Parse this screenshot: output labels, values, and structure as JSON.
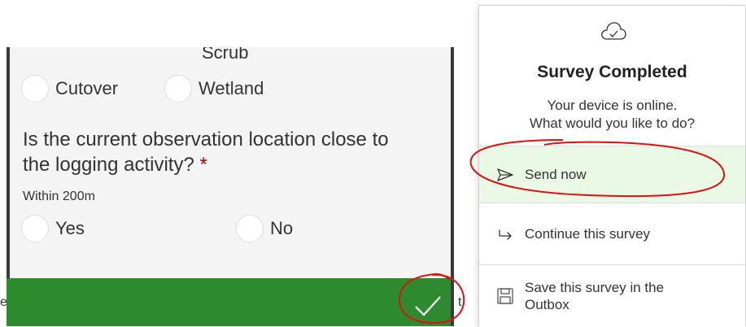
{
  "form": {
    "prev_option_fragment": "Scrub",
    "habitat_options": [
      "Cutover",
      "Wetland"
    ],
    "question": "Is the current observation location close to the logging activity?",
    "required_marker": "*",
    "hint": "Within 200m",
    "answer_options": [
      "Yes",
      "No"
    ],
    "left_edge_fragment": "e",
    "right_edge_fragment": "t",
    "submit_icon": "check-icon"
  },
  "popup": {
    "icon": "cloud-check-icon",
    "title": "Survey Completed",
    "message_line1": "Your device is online.",
    "message_line2": "What would you like to do?",
    "actions": [
      {
        "icon": "send-icon",
        "label": "Send now",
        "highlighted": true
      },
      {
        "icon": "continue-arrow-icon",
        "label": "Continue this survey"
      },
      {
        "icon": "save-icon",
        "label_line1": "Save this survey in the",
        "label_line2": "Outbox"
      }
    ]
  },
  "colors": {
    "submit_bar": "#2e8a2e",
    "highlight_bg": "#eaf8e6",
    "annotation_red": "#e01010",
    "required_star": "#b00000"
  }
}
